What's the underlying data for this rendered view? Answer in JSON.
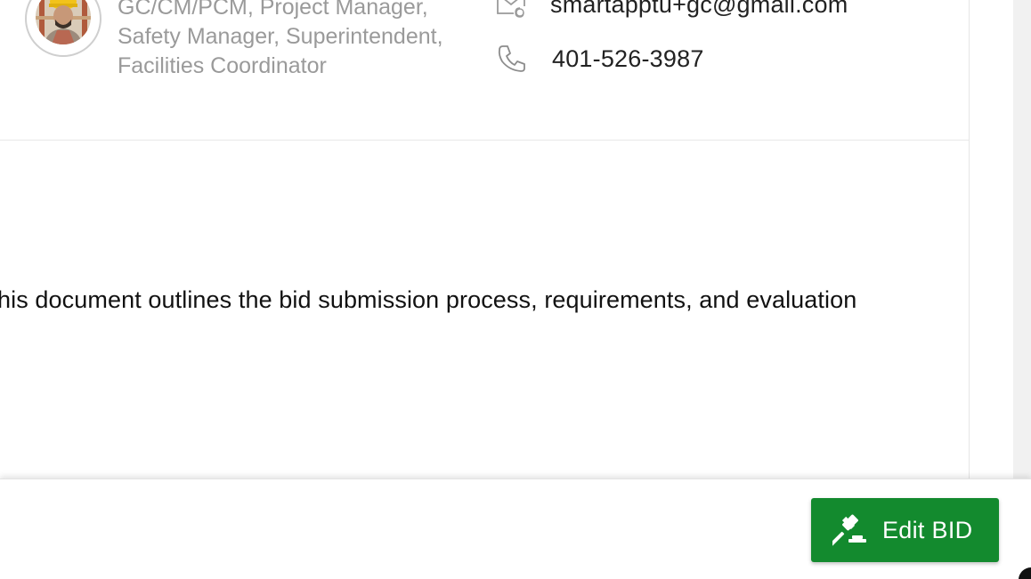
{
  "profile": {
    "roles": [
      "GC/CM/PCM, Project Manager,",
      "Safety Manager, Superintendent,",
      "Facilities Coordinator"
    ],
    "email": "smartapptu+gc@gmail.com",
    "phone": "401-526-3987",
    "avatar_icon": "user-photo-icon"
  },
  "description": "his document outlines the bid submission process, requirements, and evaluation",
  "actions": {
    "edit_bid_label": "Edit BID",
    "edit_bid_icon": "gavel-icon",
    "edit_bid_color": "#138a2e"
  },
  "icons": {
    "email": "email-at-icon",
    "phone": "phone-icon"
  }
}
